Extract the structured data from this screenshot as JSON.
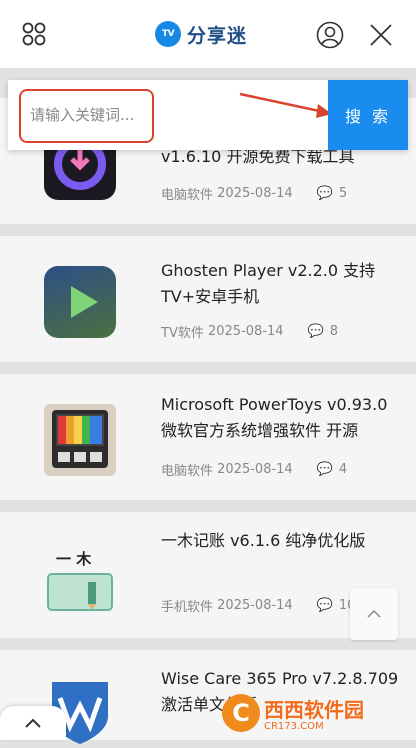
{
  "header": {
    "logo_badge": "TV",
    "logo_text": "分享迷"
  },
  "search": {
    "placeholder": "请输入关键词...",
    "button_label": "搜 索"
  },
  "articles": [
    {
      "title": "v1.6.10 开源免费下载工具",
      "category": "电脑软件",
      "date": "2025-08-14",
      "comments": "5"
    },
    {
      "title": "Ghosten Player v2.2.0 支持TV+安卓手机",
      "category": "TV软件",
      "date": "2025-08-14",
      "comments": "8"
    },
    {
      "title": "Microsoft PowerToys v0.93.0 微软官方系统增强软件 开源",
      "category": "电脑软件",
      "date": "2025-08-14",
      "comments": "4"
    },
    {
      "title": "一木记账 v6.1.6 纯净优化版",
      "category": "手机软件",
      "date": "2025-08-14",
      "comments": "10"
    },
    {
      "title": "Wise Care 365 Pro v7.2.8.709 激活单文件版",
      "category": "",
      "date": "",
      "comments": ""
    }
  ],
  "thumb_text": {
    "yimu": "一 木"
  },
  "watermark": {
    "main": "西西软件园",
    "sub": "CR173.COM",
    "badge": "C"
  },
  "colors": {
    "accent": "#1a8cf0",
    "annotation": "#d9442e"
  }
}
